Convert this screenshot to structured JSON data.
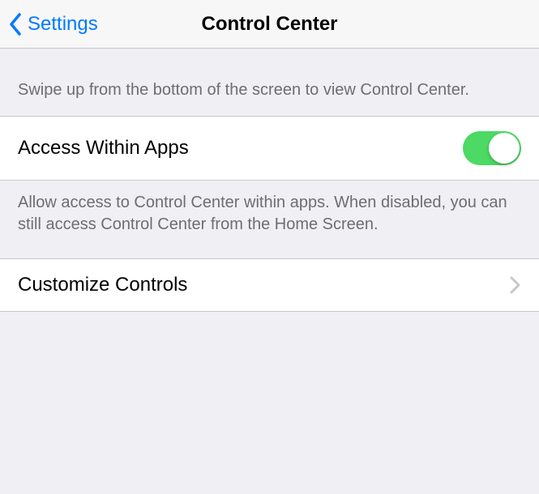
{
  "nav": {
    "back_label": "Settings",
    "title": "Control Center"
  },
  "section1": {
    "description": "Swipe up from the bottom of the screen to view Control Center.",
    "row_label": "Access Within Apps",
    "toggle_on": true,
    "footer": "Allow access to Control Center within apps. When disabled, you can still access Control Center from the Home Screen."
  },
  "section2": {
    "row_label": "Customize Controls"
  }
}
